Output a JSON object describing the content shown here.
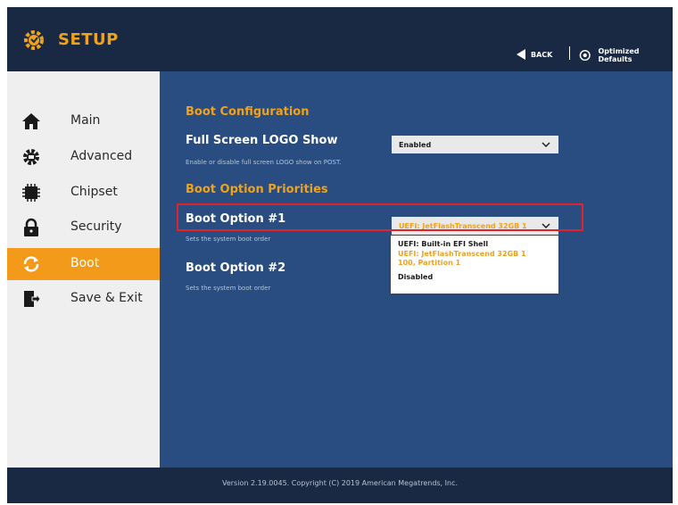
{
  "header": {
    "title": "SETUP",
    "back_label": "BACK",
    "optimized_defaults_label": "Optimized Defaults"
  },
  "sidebar": {
    "items": [
      {
        "label": "Main",
        "icon": "home-icon",
        "active": false
      },
      {
        "label": "Advanced",
        "icon": "advanced-gear-icon",
        "active": false
      },
      {
        "label": "Chipset",
        "icon": "chip-icon",
        "active": false
      },
      {
        "label": "Security",
        "icon": "lock-icon",
        "active": false
      },
      {
        "label": "Boot",
        "icon": "refresh-icon",
        "active": true
      },
      {
        "label": "Save & Exit",
        "icon": "exit-door-icon",
        "active": false
      }
    ]
  },
  "main": {
    "boot_configuration": {
      "heading": "Boot Configuration",
      "logo_show": {
        "title": "Full Screen LOGO Show",
        "description": "Enable or disable full screen LOGO show on POST.",
        "value": "Enabled"
      }
    },
    "boot_priorities": {
      "heading": "Boot Option Priorities",
      "option1": {
        "title": "Boot Option #1",
        "description": "Sets the system boot order",
        "value": "UEFI: JetFlashTranscend 32GB 1"
      },
      "option2": {
        "title": "Boot Option #2",
        "description": "Sets the system boot order"
      }
    },
    "dropdown": {
      "options": [
        {
          "line1": "UEFI: Built-in EFI Shell",
          "line2": "",
          "selected": false
        },
        {
          "line1": "UEFI: JetFlashTranscend 32GB 1",
          "line2": "100, Partition 1",
          "selected": true
        },
        {
          "line1": "Disabled",
          "line2": "",
          "selected": false
        }
      ]
    }
  },
  "footer": {
    "text": "Version 2.19.0045. Copyright (C) 2019 American Megatrends, Inc."
  },
  "colors": {
    "accent": "#f0a21b",
    "background": "#294d80",
    "topbar": "#1a2943",
    "sidebar": "#efefef",
    "active_item": "#f39a1a",
    "highlight_border": "#e2222a"
  }
}
